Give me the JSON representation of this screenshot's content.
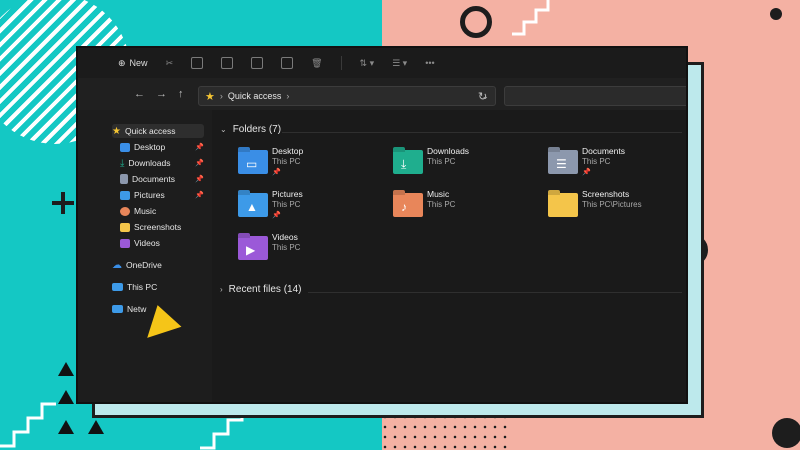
{
  "colors": {
    "teal": "#14c8c4",
    "salmon": "#f4b1a3",
    "window_bg": "#202020",
    "accent_yellow": "#f5c533"
  },
  "commandbar": {
    "new_label": "New",
    "icons": [
      "cut-icon",
      "copy-icon",
      "paste-icon",
      "rename-icon",
      "share-icon",
      "delete-icon",
      "sort-icon",
      "view-icon",
      "more-icon"
    ]
  },
  "address": {
    "path_label": "Quick access",
    "icon": "star-icon"
  },
  "sidebar": {
    "items": [
      {
        "label": "Quick access",
        "icon": "star-icon",
        "pinned": false
      },
      {
        "label": "Desktop",
        "icon": "desktop-icon",
        "pinned": true
      },
      {
        "label": "Downloads",
        "icon": "download-icon",
        "pinned": true
      },
      {
        "label": "Documents",
        "icon": "documents-icon",
        "pinned": true
      },
      {
        "label": "Pictures",
        "icon": "pictures-icon",
        "pinned": true
      },
      {
        "label": "Music",
        "icon": "music-icon",
        "pinned": false
      },
      {
        "label": "Screenshots",
        "icon": "folder-icon",
        "pinned": false
      },
      {
        "label": "Videos",
        "icon": "videos-icon",
        "pinned": false
      },
      {
        "label": "OneDrive",
        "icon": "cloud-icon",
        "pinned": false
      },
      {
        "label": "This PC",
        "icon": "pc-icon",
        "pinned": false
      },
      {
        "label": "Netw",
        "icon": "network-icon",
        "pinned": false
      }
    ]
  },
  "main": {
    "folders_header": "Folders (7)",
    "recent_header": "Recent files (14)",
    "folders": [
      {
        "name": "Desktop",
        "location": "This PC",
        "pinned": true,
        "icon": "desktop-folder-icon",
        "color": "#3a8ee6"
      },
      {
        "name": "Downloads",
        "location": "This PC",
        "pinned": false,
        "icon": "downloads-folder-icon",
        "color": "#1fae8e"
      },
      {
        "name": "Documents",
        "location": "This PC",
        "pinned": true,
        "icon": "documents-folder-icon",
        "color": "#8c98ad"
      },
      {
        "name": "Pictures",
        "location": "This PC",
        "pinned": true,
        "icon": "pictures-folder-icon",
        "color": "#3d9ae8"
      },
      {
        "name": "Music",
        "location": "This PC",
        "pinned": false,
        "icon": "music-folder-icon",
        "color": "#e8865a"
      },
      {
        "name": "Screenshots",
        "location": "This PC\\Pictures",
        "pinned": false,
        "icon": "screenshots-folder-icon",
        "color": "#f4c54a"
      },
      {
        "name": "Videos",
        "location": "This PC",
        "pinned": false,
        "icon": "videos-folder-icon",
        "color": "#9b59d8"
      }
    ]
  }
}
